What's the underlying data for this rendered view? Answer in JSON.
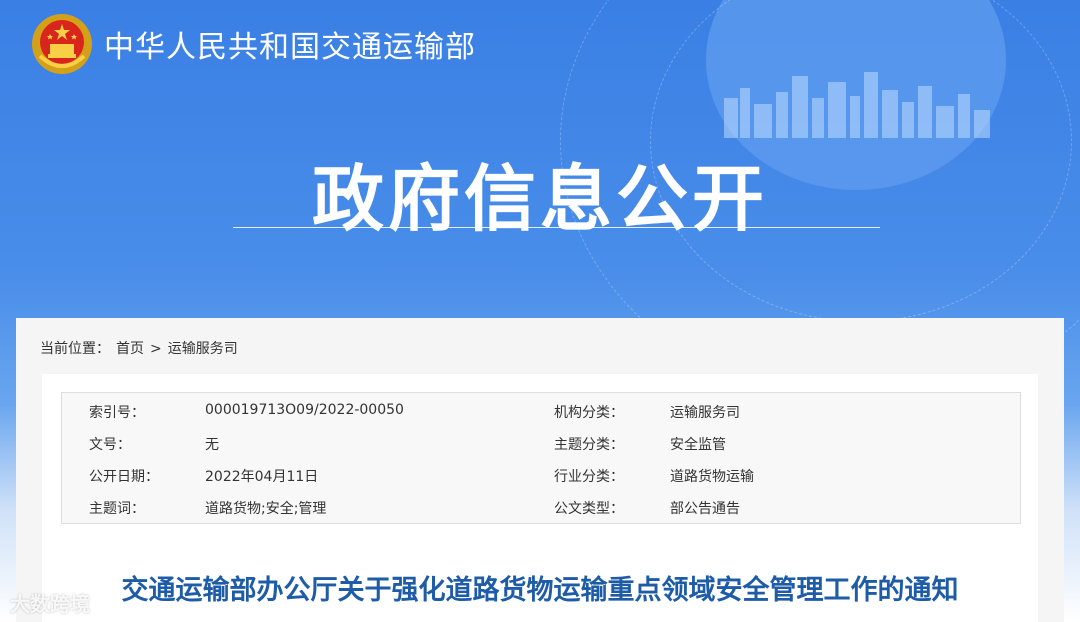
{
  "header": {
    "ministry_name": "中华人民共和国交通运输部",
    "section_title": "政府信息公开"
  },
  "breadcrumb": {
    "prefix": "当前位置：",
    "home": "首页",
    "separator": ">",
    "current": "运输服务司"
  },
  "meta": {
    "rows": [
      {
        "label1": "索引号：",
        "value1": "000019713O09/2022-00050",
        "label2": "机构分类：",
        "value2": "运输服务司"
      },
      {
        "label1": "文号：",
        "value1": "无",
        "label2": "主题分类：",
        "value2": "安全监管"
      },
      {
        "label1": "公开日期：",
        "value1": "2022年04月11日",
        "label2": "行业分类：",
        "value2": "道路货物运输"
      },
      {
        "label1": "主题词：",
        "value1": "道路货物;安全;管理",
        "label2": "公文类型：",
        "value2": "部公告通告"
      }
    ]
  },
  "document": {
    "title": "交通运输部办公厅关于强化道路货物运输重点领域安全管理工作的通知"
  },
  "watermark": {
    "text": "大数跨境"
  },
  "colors": {
    "banner_blue": "#3f86e6",
    "title_blue": "#1f5ca8"
  }
}
